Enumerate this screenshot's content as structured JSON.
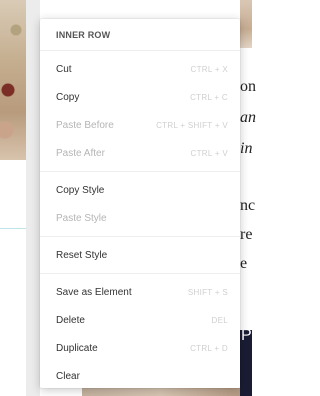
{
  "background": {
    "text_lines": [
      "on",
      "an",
      "in",
      "nc",
      "re",
      "e"
    ],
    "dark_panel_letter": "P"
  },
  "menu": {
    "title": "INNER ROW",
    "items": [
      {
        "label": "Cut",
        "shortcut": "CTRL + X",
        "enabled": true
      },
      {
        "label": "Copy",
        "shortcut": "CTRL + C",
        "enabled": true
      },
      {
        "label": "Paste Before",
        "shortcut": "CTRL + SHIFT + V",
        "enabled": false
      },
      {
        "label": "Paste After",
        "shortcut": "CTRL + V",
        "enabled": false
      },
      {
        "label": "Copy Style",
        "shortcut": "",
        "enabled": true
      },
      {
        "label": "Paste Style",
        "shortcut": "",
        "enabled": false
      },
      {
        "label": "Reset Style",
        "shortcut": "",
        "enabled": true
      },
      {
        "label": "Save as Element",
        "shortcut": "SHIFT + S",
        "enabled": true
      },
      {
        "label": "Delete",
        "shortcut": "DEL",
        "enabled": true
      },
      {
        "label": "Duplicate",
        "shortcut": "CTRL + D",
        "enabled": true
      },
      {
        "label": "Clear",
        "shortcut": "",
        "enabled": true
      }
    ]
  }
}
